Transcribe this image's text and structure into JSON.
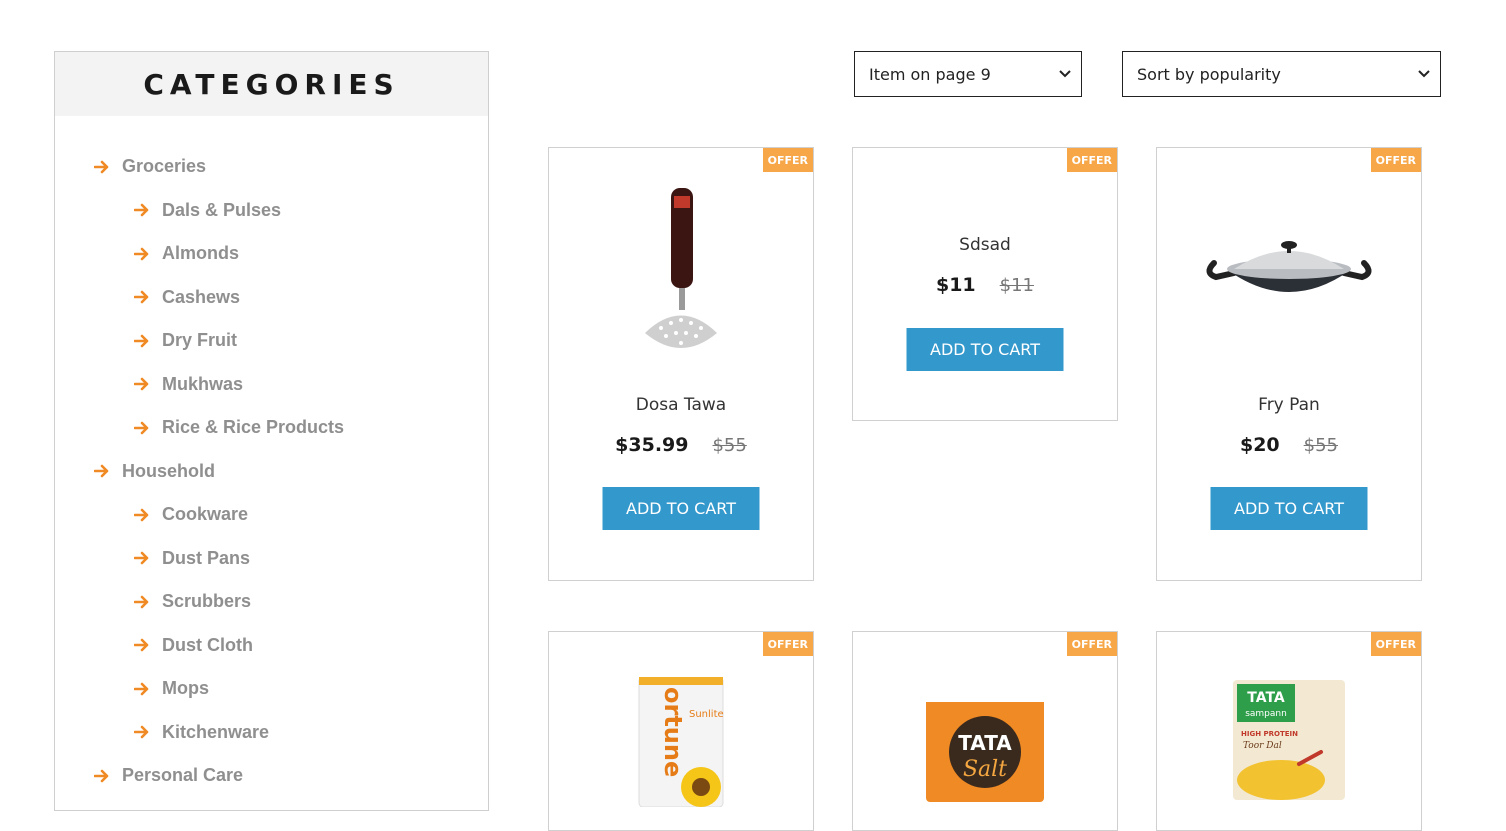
{
  "sidebar": {
    "title": "CATEGORIES",
    "categories": [
      {
        "label": "Groceries",
        "level": 0
      },
      {
        "label": "Dals & Pulses",
        "level": 1
      },
      {
        "label": "Almonds",
        "level": 1
      },
      {
        "label": "Cashews",
        "level": 1
      },
      {
        "label": "Dry Fruit",
        "level": 1
      },
      {
        "label": "Mukhwas",
        "level": 1
      },
      {
        "label": "Rice & Rice Products",
        "level": 1
      },
      {
        "label": "Household",
        "level": 0
      },
      {
        "label": "Cookware",
        "level": 1
      },
      {
        "label": "Dust Pans",
        "level": 1
      },
      {
        "label": "Scrubbers",
        "level": 1
      },
      {
        "label": "Dust Cloth",
        "level": 1
      },
      {
        "label": "Mops",
        "level": 1
      },
      {
        "label": "Kitchenware",
        "level": 1
      },
      {
        "label": "Personal Care",
        "level": 0
      }
    ]
  },
  "toolbar": {
    "per_page_selected": "Item on page 9",
    "sort_selected": "Sort by popularity"
  },
  "colors": {
    "accent_orange": "#f7a648",
    "arrow_orange": "#f08a24",
    "button_blue": "#3398cc"
  },
  "products": [
    {
      "name": "Dosa Tawa",
      "price": "$35.99",
      "old_price": "$55",
      "badge": "OFFER",
      "button": "ADD TO CART",
      "image": "masher-image"
    },
    {
      "name": "Sdsad",
      "price": "$11",
      "old_price": "$11",
      "badge": "OFFER",
      "button": "ADD TO CART",
      "image": ""
    },
    {
      "name": "Fry Pan",
      "price": "$20",
      "old_price": "$55",
      "badge": "OFFER",
      "button": "ADD TO CART",
      "image": "kadai-image"
    },
    {
      "badge": "OFFER",
      "image": "oil-pack-image",
      "image_text": [
        "ortune",
        "Sunlite"
      ]
    },
    {
      "badge": "OFFER",
      "image": "salt-pack-image",
      "image_text": [
        "TATA",
        "Salt"
      ]
    },
    {
      "badge": "OFFER",
      "image": "dal-pack-image",
      "image_text": [
        "TATA",
        "sampann",
        "HIGH PROTEIN",
        "Toor Dal"
      ]
    }
  ]
}
